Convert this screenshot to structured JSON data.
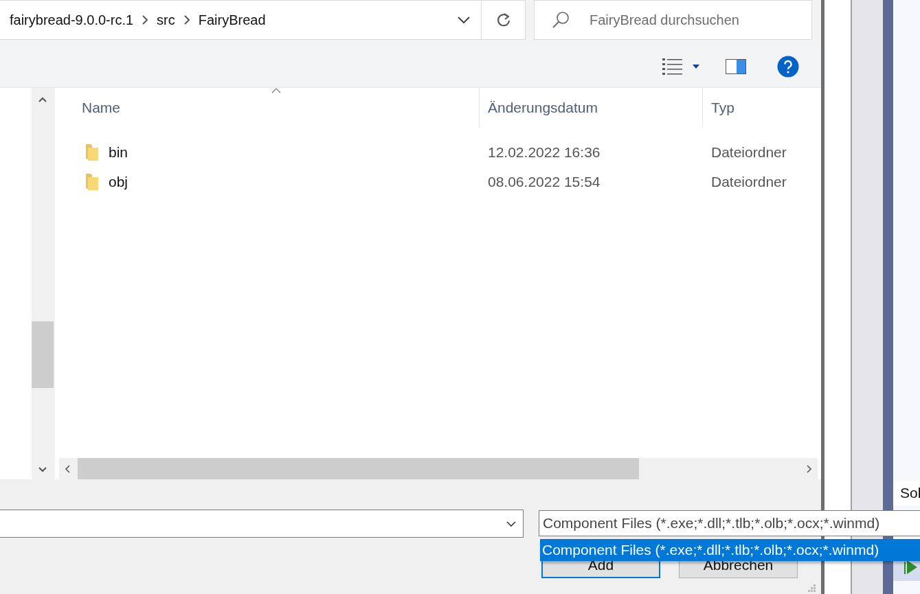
{
  "address_bar": {
    "breadcrumb": [
      "fairybread-9.0.0-rc.1",
      "src",
      "FairyBread"
    ]
  },
  "search": {
    "placeholder": "FairyBread durchsuchen"
  },
  "file_list": {
    "columns": [
      "Name",
      "Änderungsdatum",
      "Typ"
    ],
    "rows": [
      {
        "name": "bin",
        "modified": "12.02.2022 16:36",
        "type": "Dateiordner"
      },
      {
        "name": "obj",
        "modified": "08.06.2022 15:54",
        "type": "Dateiordner"
      }
    ]
  },
  "file_type": {
    "value": "Component Files (*.exe;*.dll;*.tlb;*.olb;*.ocx;*.winmd)",
    "options": [
      {
        "label": "Component Files (*.exe;*.dll;*.tlb;*.olb;*.ocx;*.winmd)",
        "selected": true
      }
    ]
  },
  "buttons": [
    {
      "label": "Add",
      "default": true
    },
    {
      "label": "Abbrechen",
      "default": false
    }
  ],
  "background_window": {
    "panel_text": "Sol"
  }
}
